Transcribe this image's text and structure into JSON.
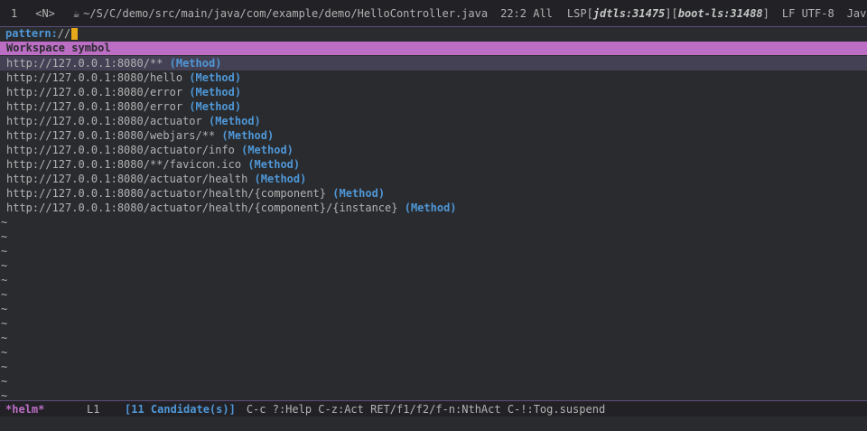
{
  "modeline": {
    "window_number": "1",
    "evil_state": "<N>",
    "icon": "java-icon",
    "file_path": "~/S/C/demo/src/main/java/com/example/demo/HelloController.java",
    "position": "22:2 All",
    "lsp_prefix": "LSP[",
    "lsp_server1": "jdtls:31475",
    "lsp_mid": "][",
    "lsp_server2": "boot-ls:31488",
    "lsp_suffix": "]",
    "eol_encoding": "LF UTF-8",
    "major_mode": "Java//l"
  },
  "prompt": {
    "label": "pattern: ",
    "input": "//"
  },
  "source_header": "Workspace symbol",
  "candidates": [
    {
      "url": "http://127.0.0.1:8080/**",
      "kind": "(Method)"
    },
    {
      "url": "http://127.0.0.1:8080/hello",
      "kind": "(Method)"
    },
    {
      "url": "http://127.0.0.1:8080/error",
      "kind": "(Method)"
    },
    {
      "url": "http://127.0.0.1:8080/error",
      "kind": "(Method)"
    },
    {
      "url": "http://127.0.0.1:8080/actuator",
      "kind": "(Method)"
    },
    {
      "url": "http://127.0.0.1:8080/webjars/**",
      "kind": "(Method)"
    },
    {
      "url": "http://127.0.0.1:8080/actuator/info",
      "kind": "(Method)"
    },
    {
      "url": "http://127.0.0.1:8080/**/favicon.ico",
      "kind": "(Method)"
    },
    {
      "url": "http://127.0.0.1:8080/actuator/health",
      "kind": "(Method)"
    },
    {
      "url": "http://127.0.0.1:8080/actuator/health/{component}",
      "kind": "(Method)"
    },
    {
      "url": "http://127.0.0.1:8080/actuator/health/{component}/{instance}",
      "kind": "(Method)"
    }
  ],
  "tilde_char": "~",
  "helm_line": {
    "name": "*helm*",
    "line": "L1",
    "count": "[11 Candidate(s)]",
    "help": "C-c ?:Help C-z:Act RET/f1/f2/f-n:NthAct C-!:Tog.suspend"
  },
  "colors": {
    "background": "#292b2e",
    "header": "#bc6ec5",
    "keyword": "#4f97d7",
    "selection": "#444155",
    "cursor": "#e6a91a"
  }
}
